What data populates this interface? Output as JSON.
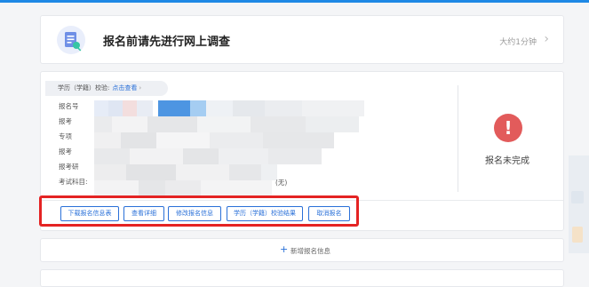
{
  "survey": {
    "title": "报名前请先进行网上调查",
    "time": "大约1分钟",
    "chevron": "›"
  },
  "registration": {
    "verify_label": "学历（学籍）校验:",
    "verify_link": "点击查看",
    "verify_arrow": "›",
    "info_rows": [
      "报名号",
      "报考",
      "专项",
      "报考",
      "报考研",
      "考试科目:"
    ],
    "exam_subjects_tail": "(无)",
    "status_icon": "!",
    "status_text": "报名未完成",
    "status_color": "#e25b5b",
    "accent_color": "#2a70d8"
  },
  "actions": {
    "download": "下载报名信息表",
    "view_details": "查看详细",
    "modify": "修改报名信息",
    "verify_result": "学历（学籍）校验结果",
    "cancel": "取消报名"
  },
  "add_registration": {
    "plus": "+",
    "label": "新增报名信息"
  },
  "highlight_color": "#e42323"
}
